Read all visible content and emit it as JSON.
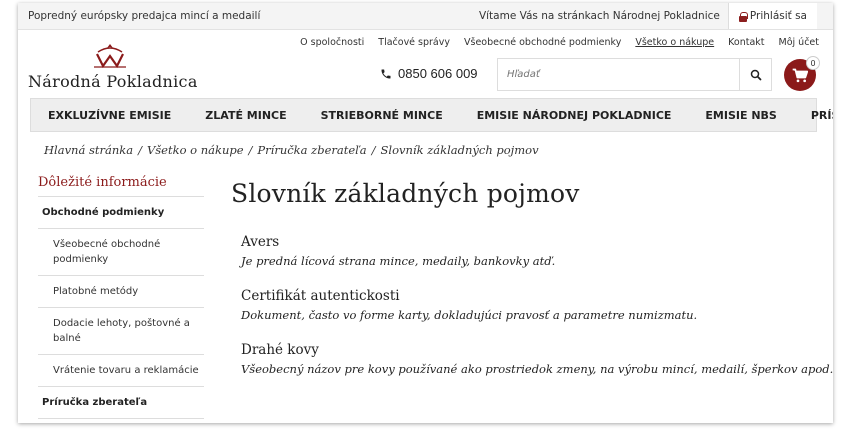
{
  "topbar": {
    "tagline": "Popredný európsky predajca mincí a medailí",
    "welcome": "Vítame Vás na stránkach Národnej Pokladnice",
    "login_label": "Prihlásiť sa"
  },
  "header": {
    "logo_text": "Národná Pokladnica",
    "links": [
      "O spoločnosti",
      "Tlačové správy",
      "Všeobecné obchodné podmienky",
      "Všetko o nákupe",
      "Kontakt",
      "Môj účet"
    ],
    "phone": "0850 606 009",
    "search_placeholder": "Hľadať",
    "cart_count": "0"
  },
  "nav": {
    "items": [
      "EXKLUZÍVNE EMISIE",
      "ZLATÉ MINCE",
      "STRIEBORNÉ MINCE",
      "EMISIE NÁRODNEJ POKLADNICE",
      "EMISIE NBS",
      "PRÍSLUŠENSTVO"
    ]
  },
  "breadcrumb": [
    "Hlavná stránka",
    "Všetko o nákupe",
    "Príručka zberateľa",
    "Slovník základných pojmov"
  ],
  "sidebar": {
    "title": "Dôležité informácie",
    "section1": "Obchodné podmienky",
    "items": [
      "Všeobecné obchodné podmienky",
      "Platobné metódy",
      "Dodacie lehoty, poštovné a balné",
      "Vrátenie tovaru a reklamácie"
    ],
    "section2": "Príručka zberateľa"
  },
  "main": {
    "title": "Slovník základných pojmov",
    "terms": [
      {
        "name": "Avers",
        "desc": "Je predná lícová strana mince, medaily, bankovky atď."
      },
      {
        "name": "Certifikát autentickosti",
        "desc": "Dokument, často vo forme karty, dokladujúci pravosť a parametre numizmatu."
      },
      {
        "name": "Drahé kovy",
        "desc": "Všeobecný názov pre kovy používané ako prostriedok zmeny, na výrobu mincí, medailí, šperkov apod."
      }
    ]
  },
  "colors": {
    "brand": "#8b1a1a",
    "nav_bg": "#eeeeee"
  },
  "icons": [
    "lock-icon",
    "logo-emblem-icon",
    "phone-icon",
    "search-icon",
    "cart-icon"
  ]
}
